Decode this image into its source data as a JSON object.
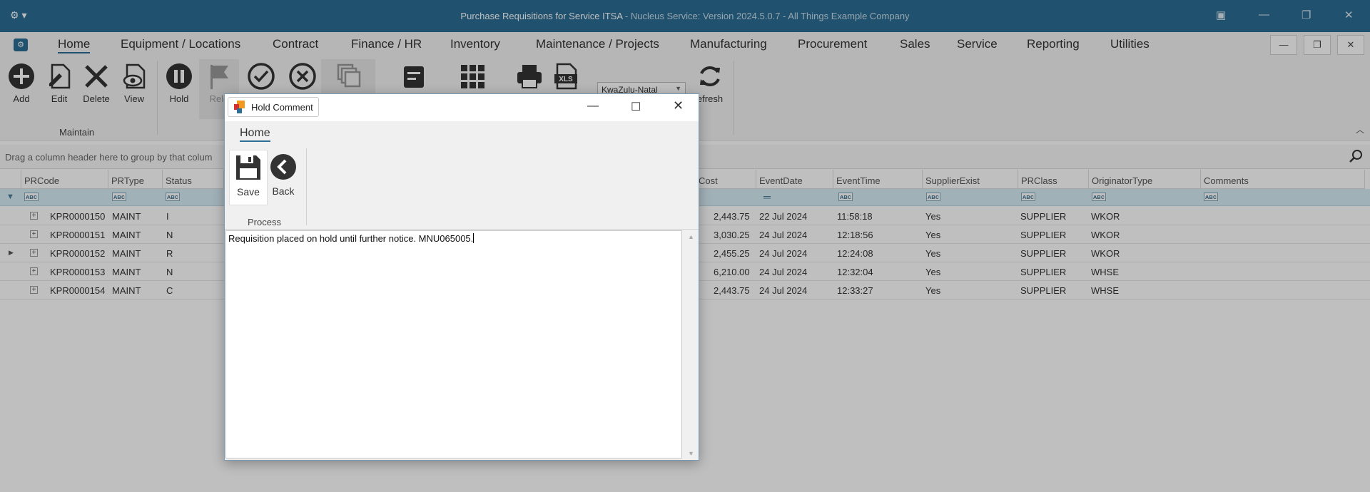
{
  "window": {
    "title_main": "Purchase Requisitions for Service ITSA",
    "title_rest": " - Nucleus Service: Version 2024.5.0.7 - All Things Example Company"
  },
  "menu": {
    "tabs": [
      "Home",
      "Equipment / Locations",
      "Contract",
      "Finance / HR",
      "Inventory",
      "Maintenance / Projects",
      "Manufacturing",
      "Procurement",
      "Sales",
      "Service",
      "Reporting",
      "Utilities"
    ],
    "active_tab": "Home"
  },
  "ribbon": {
    "buttons": {
      "add": "Add",
      "edit": "Edit",
      "delete": "Delete",
      "view": "View",
      "hold": "Hold",
      "release": "Rele",
      "refresh": "efresh"
    },
    "group_maintain": "Maintain",
    "region_select": "KwaZulu-Natal"
  },
  "groupbar": {
    "hint": "Drag a column header here to group by that colum"
  },
  "grid": {
    "headers_left": [
      "PRCode",
      "PRType",
      "Status"
    ],
    "headers_right": [
      "Cost",
      "EventDate",
      "EventTime",
      "SupplierExist",
      "PRClass",
      "OriginatorType",
      "Comments"
    ],
    "rows": [
      {
        "code": "KPR0000150",
        "type": "MAINT",
        "status": "I",
        "cost": "2,443.75",
        "date": "22 Jul 2024",
        "time": "11:58:18",
        "supplier": "Yes",
        "class": "SUPPLIER",
        "orig": "WKOR",
        "comments": ""
      },
      {
        "code": "KPR0000151",
        "type": "MAINT",
        "status": "N",
        "cost": "3,030.25",
        "date": "24 Jul 2024",
        "time": "12:18:56",
        "supplier": "Yes",
        "class": "SUPPLIER",
        "orig": "WKOR",
        "comments": ""
      },
      {
        "code": "KPR0000152",
        "type": "MAINT",
        "status": "R",
        "cost": "2,455.25",
        "date": "24 Jul 2024",
        "time": "12:24:08",
        "supplier": "Yes",
        "class": "SUPPLIER",
        "orig": "WKOR",
        "comments": ""
      },
      {
        "code": "KPR0000153",
        "type": "MAINT",
        "status": "N",
        "cost": "6,210.00",
        "date": "24 Jul 2024",
        "time": "12:32:04",
        "supplier": "Yes",
        "class": "SUPPLIER",
        "orig": "WHSE",
        "comments": ""
      },
      {
        "code": "KPR0000154",
        "type": "MAINT",
        "status": "C",
        "cost": "2,443.75",
        "date": "24 Jul 2024",
        "time": "12:33:27",
        "supplier": "Yes",
        "class": "SUPPLIER",
        "orig": "WHSE",
        "comments": ""
      }
    ]
  },
  "dialog": {
    "title": "Hold Comment",
    "tab": "Home",
    "save_label": "Save",
    "back_label": "Back",
    "group_label": "Process",
    "comment_text": "Requisition placed on hold until further notice. MNU065005."
  },
  "colors": {
    "brand": "#2b6e96",
    "filter_row": "#d7ecf6"
  }
}
